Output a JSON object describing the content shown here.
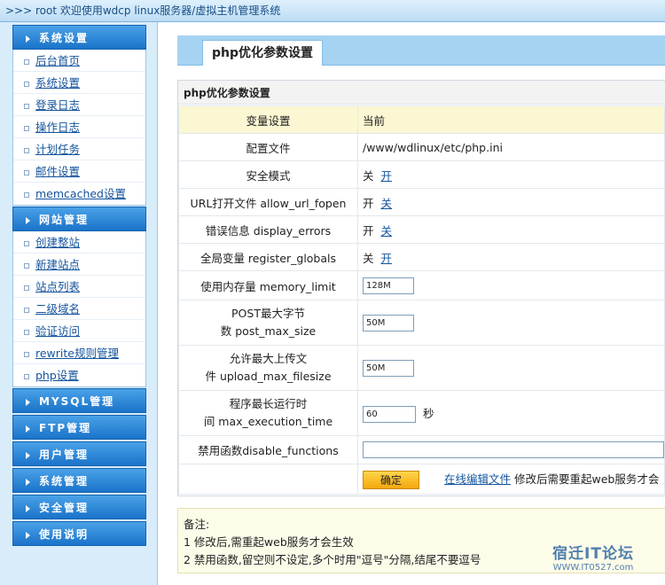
{
  "topbar": {
    "text": ">>> root 欢迎使用wdcp linux服务器/虚拟主机管理系统"
  },
  "sidebar": {
    "sections": [
      {
        "title": "系统设置",
        "items": [
          "后台首页",
          "系统设置",
          "登录日志",
          "操作日志",
          "计划任务",
          "邮件设置",
          "memcached设置"
        ]
      },
      {
        "title": "网站管理",
        "items": [
          "创建整站",
          "新建站点",
          "站点列表",
          "二级域名",
          "验证访问",
          "rewrite规则管理",
          "php设置"
        ]
      },
      {
        "title": "MYSQL管理"
      },
      {
        "title": "FTP管理"
      },
      {
        "title": "用户管理"
      },
      {
        "title": "系统管理"
      },
      {
        "title": "安全管理"
      },
      {
        "title": "使用说明"
      }
    ]
  },
  "main": {
    "tab_label": "php优化参数设置",
    "panel_title": "php优化参数设置",
    "header": {
      "label": "变量设置",
      "value": "当前"
    },
    "rows": {
      "config_file": {
        "label": "配置文件",
        "value": "/www/wdlinux/etc/php.ini"
      },
      "safe_mode": {
        "label": "安全模式",
        "current": "关",
        "link": "开"
      },
      "allow_url_fopen": {
        "label": "URL打开文件 allow_url_fopen",
        "current": "开",
        "link": "关"
      },
      "display_errors": {
        "label": "错误信息 display_errors",
        "current": "开",
        "link": "关"
      },
      "register_globals": {
        "label": "全局变量 register_globals",
        "current": "关",
        "link": "开"
      },
      "memory_limit": {
        "label": "使用内存量 memory_limit",
        "value": "128M"
      },
      "post_max_size": {
        "label_line1": "POST最大字节",
        "label_line2": "数 post_max_size",
        "value": "50M"
      },
      "upload_max_filesize": {
        "label_line1": "允许最大上传文",
        "label_line2": "件 upload_max_filesize",
        "value": "50M"
      },
      "max_execution_time": {
        "label_line1": "程序最长运行时",
        "label_line2": "间 max_execution_time",
        "value": "60",
        "unit": "秒"
      },
      "disable_functions": {
        "label": "禁用函数disable_functions",
        "value": ""
      }
    },
    "actions": {
      "ok_label": "确定",
      "edit_link": "在线编辑文件",
      "hint": "修改后需要重起web服务才会"
    }
  },
  "notes": {
    "title": "备注:",
    "line1": "1 修改后,需重起web服务才会生效",
    "line2": "2 禁用函数,留空则不设定,多个时用\"逗号\"分隔,结尾不要逗号"
  },
  "watermark": {
    "title": "宿迁IT论坛",
    "url": "WWW.IT0527.com"
  },
  "colors": {
    "menu_head": "#1a73c9",
    "tab_bar": "#a6d3f2",
    "header_row": "#fbf7d3",
    "ok_button": "#f4a70d"
  }
}
